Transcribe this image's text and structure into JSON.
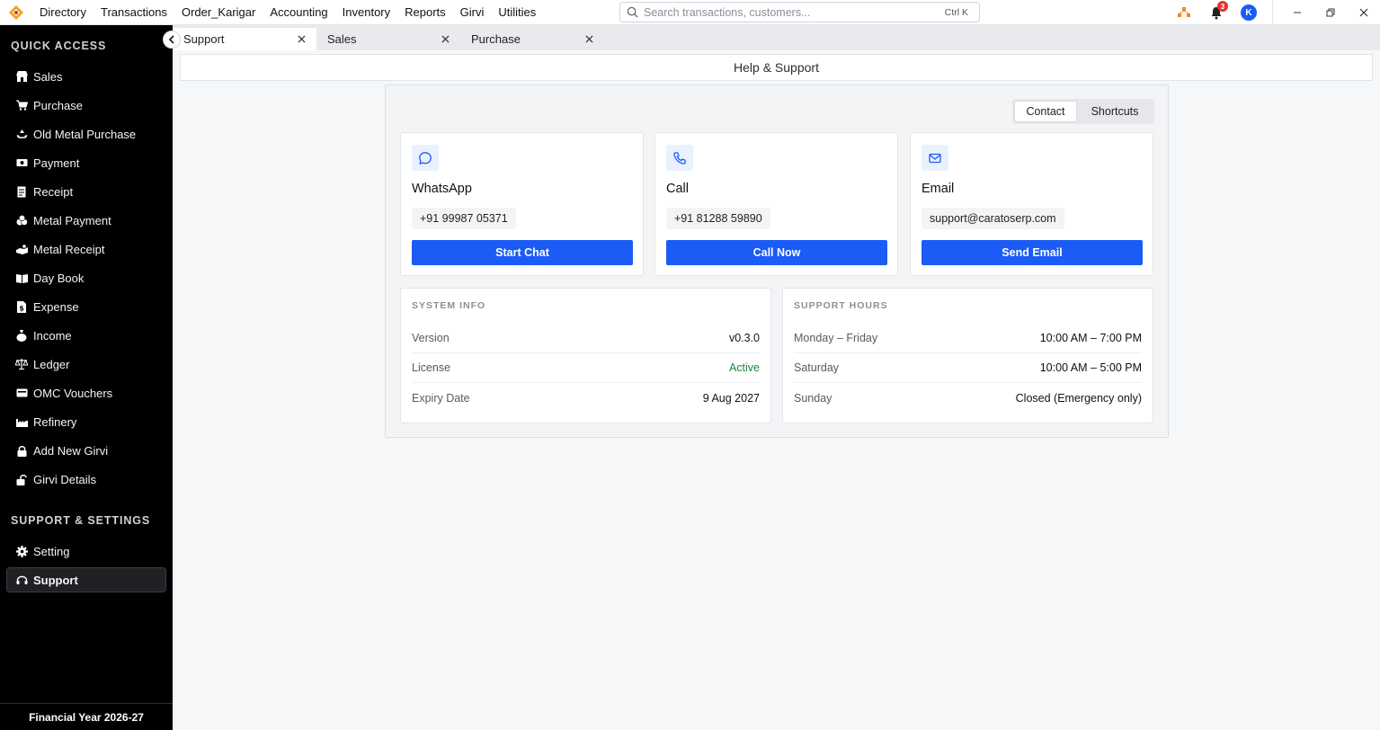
{
  "menu": [
    "Directory",
    "Transactions",
    "Order_Karigar",
    "Accounting",
    "Inventory",
    "Reports",
    "Girvi",
    "Utilities"
  ],
  "search": {
    "placeholder": "Search transactions, customers...",
    "shortcut": "Ctrl K"
  },
  "notifications": {
    "count": "3"
  },
  "user": {
    "initial": "K"
  },
  "sidebar": {
    "quick_access_title": "QUICK ACCESS",
    "items": [
      {
        "label": "Sales",
        "icon": "store-icon"
      },
      {
        "label": "Purchase",
        "icon": "cart-icon"
      },
      {
        "label": "Old Metal Purchase",
        "icon": "recycle-icon"
      },
      {
        "label": "Payment",
        "icon": "money-icon"
      },
      {
        "label": "Receipt",
        "icon": "receipt-icon"
      },
      {
        "label": "Metal Payment",
        "icon": "coins-icon"
      },
      {
        "label": "Metal Receipt",
        "icon": "hand-coins-icon"
      },
      {
        "label": "Day Book",
        "icon": "book-icon"
      },
      {
        "label": "Expense",
        "icon": "file-dollar-icon"
      },
      {
        "label": "Income",
        "icon": "money-bag-icon"
      },
      {
        "label": "Ledger",
        "icon": "scale-icon"
      },
      {
        "label": "OMC Vouchers",
        "icon": "voucher-icon"
      },
      {
        "label": "Refinery",
        "icon": "factory-icon"
      },
      {
        "label": "Add New Girvi",
        "icon": "lock-icon"
      },
      {
        "label": "Girvi Details",
        "icon": "unlock-icon"
      }
    ],
    "support_title": "SUPPORT & SETTINGS",
    "support_items": [
      {
        "label": "Setting",
        "icon": "gear-icon"
      },
      {
        "label": "Support",
        "icon": "headset-icon"
      }
    ],
    "financial_year": "Financial Year 2026-27"
  },
  "tabs": [
    {
      "label": "Support",
      "active": true
    },
    {
      "label": "Sales",
      "active": false
    },
    {
      "label": "Purchase",
      "active": false
    }
  ],
  "page": {
    "title": "Help & Support"
  },
  "segment": {
    "contact": "Contact",
    "shortcuts": "Shortcuts"
  },
  "cards": [
    {
      "title": "WhatsApp",
      "value": "+91 99987 05371",
      "button": "Start Chat",
      "icon": "chat-icon"
    },
    {
      "title": "Call",
      "value": "+91 81288 59890",
      "button": "Call Now",
      "icon": "phone-icon"
    },
    {
      "title": "Email",
      "value": "support@caratoserp.com",
      "button": "Send Email",
      "icon": "mail-icon"
    }
  ],
  "system_info": {
    "title": "SYSTEM INFO",
    "rows": [
      {
        "key": "Version",
        "value": "v0.3.0"
      },
      {
        "key": "License",
        "value": "Active"
      },
      {
        "key": "Expiry Date",
        "value": "9 Aug 2027"
      }
    ]
  },
  "support_hours": {
    "title": "SUPPORT HOURS",
    "rows": [
      {
        "key": "Monday – Friday",
        "value": "10:00 AM – 7:00 PM"
      },
      {
        "key": "Saturday",
        "value": "10:00 AM – 5:00 PM"
      },
      {
        "key": "Sunday",
        "value": "Closed (Emergency only)"
      }
    ]
  },
  "colors": {
    "accent": "#1a5cf5",
    "active_green": "#1a8a3a",
    "sidebar_bg": "#000000"
  }
}
